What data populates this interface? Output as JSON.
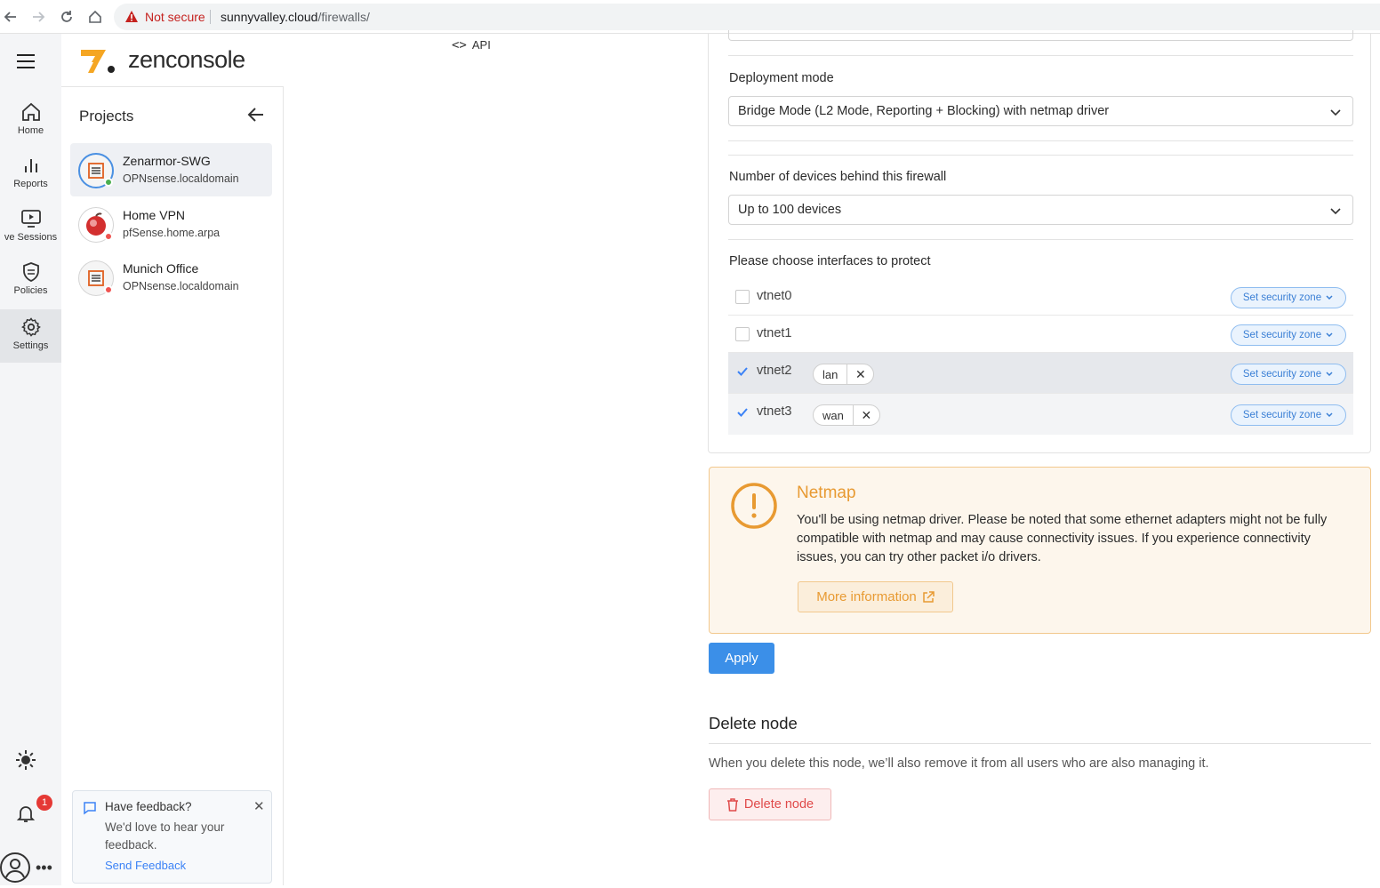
{
  "browser": {
    "not_secure": "Not secure",
    "url_domain": "sunnyvalley.cloud",
    "url_path": "/firewalls/"
  },
  "brand": {
    "logo_text": "zenconsole",
    "accent": "#f5a623"
  },
  "rail": {
    "items": [
      {
        "label": "Home",
        "icon": "home-icon"
      },
      {
        "label": "Reports",
        "icon": "bar-chart-icon"
      },
      {
        "label": "ve Sessions",
        "icon": "play-screen-icon"
      },
      {
        "label": "Policies",
        "icon": "shield-icon"
      },
      {
        "label": "Settings",
        "icon": "gear-icon"
      }
    ],
    "notification_count": "1"
  },
  "projects": {
    "title": "Projects",
    "items": [
      {
        "name": "Zenarmor-SWG",
        "host": "OPNsense.localdomain",
        "status": "online"
      },
      {
        "name": "Home VPN",
        "host": "pfSense.home.arpa",
        "status": "offline"
      },
      {
        "name": "Munich Office",
        "host": "OPNsense.localdomain",
        "status": "offline"
      }
    ]
  },
  "feedback": {
    "title": "Have feedback?",
    "body": "We'd love to hear your feedback.",
    "link": "Send Feedback"
  },
  "api_link": "API",
  "form": {
    "deployment_label": "Deployment mode",
    "deployment_value": "Bridge Mode (L2 Mode, Reporting + Blocking) with netmap driver",
    "devices_label": "Number of devices behind this firewall",
    "devices_value": "Up to 100 devices",
    "interfaces_label": "Please choose interfaces to protect",
    "zone_button": "Set security zone",
    "interfaces": [
      {
        "name": "vtnet0",
        "checked": false,
        "tag": ""
      },
      {
        "name": "vtnet1",
        "checked": false,
        "tag": ""
      },
      {
        "name": "vtnet2",
        "checked": true,
        "tag": "lan"
      },
      {
        "name": "vtnet3",
        "checked": true,
        "tag": "wan"
      }
    ]
  },
  "alert": {
    "title": "Netmap",
    "body": "You'll be using netmap driver. Please be noted that some ethernet adapters might not be fully compatible with netmap and may cause connectivity issues. If you experience connectivity issues, you can try other packet i/o drivers.",
    "button": "More information"
  },
  "apply_label": "Apply",
  "delete": {
    "title": "Delete node",
    "description": "When you delete this node, we’ll also remove it from all users who are also managing it.",
    "button": "Delete node"
  }
}
